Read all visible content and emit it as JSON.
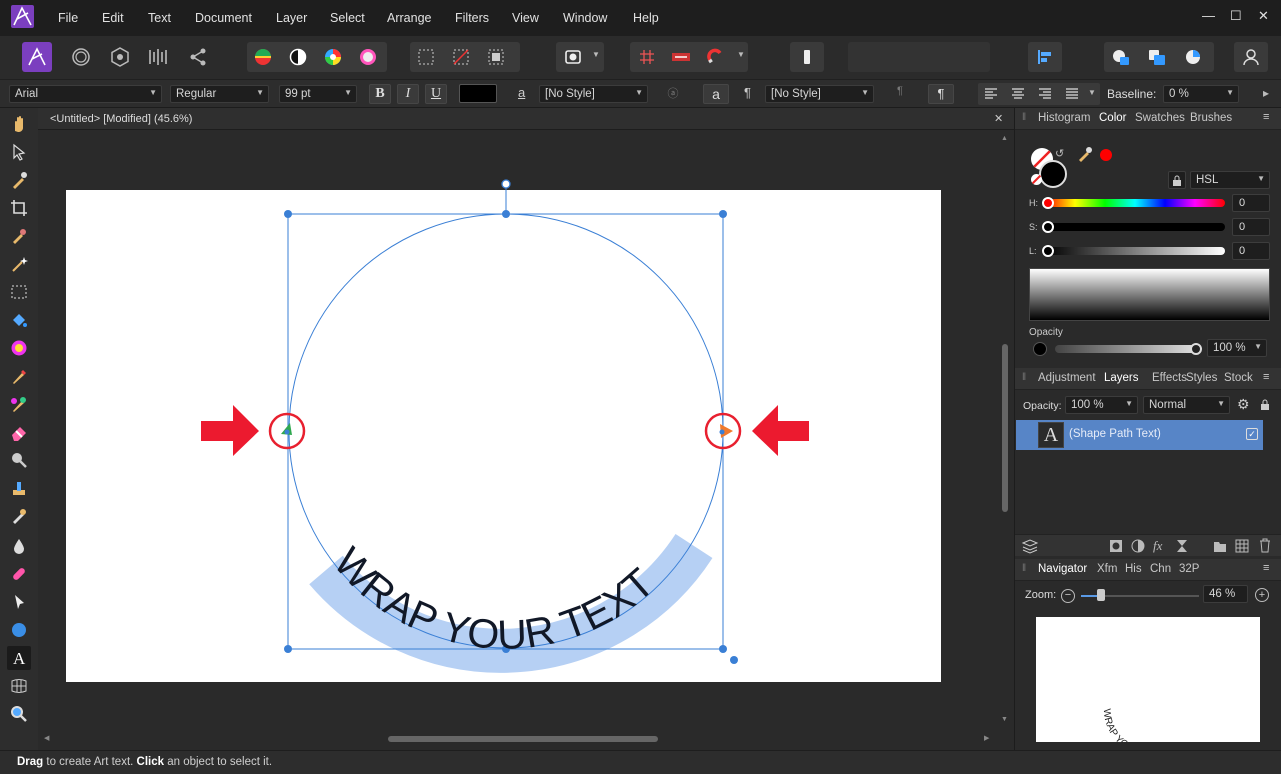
{
  "menu": {
    "items": [
      "File",
      "Edit",
      "Text",
      "Document",
      "Layer",
      "Select",
      "Arrange",
      "Filters",
      "View",
      "Window",
      "Help"
    ],
    "window_controls": {
      "minimize": "—",
      "maximize": "☐",
      "close": "✕"
    }
  },
  "toolbar": {
    "personas": [
      "photo-persona-icon",
      "liquify-persona-icon",
      "develop-persona-icon",
      "tone-mapping-persona-icon",
      "export-persona-icon"
    ],
    "icons": [
      "color-wheel-icon",
      "contrast-icon",
      "hue-icon",
      "white-balance-icon",
      "marquee-icon",
      "deselect-icon",
      "invert-selection-icon",
      "quick-mask-icon",
      "grid-icon",
      "assistant-icon",
      "snapping-icon",
      "snapping-options-icon",
      "insert-icon",
      "align-icon",
      "boolean-add-icon",
      "boolean-subtract-icon",
      "boolean-intersect-icon",
      "user-icon"
    ]
  },
  "context": {
    "font_family": "Arial",
    "font_style": "Regular",
    "font_size": "99 pt",
    "bold": "B",
    "italic": "I",
    "underline": "U",
    "char_style": "[No Style]",
    "para_style": "[No Style]",
    "case_glyph": "a",
    "case_glyph2": "a",
    "pilcrow": "¶",
    "baseline_label": "Baseline:",
    "baseline_value": "0 %",
    "fill_color": "#000000"
  },
  "document": {
    "tab_title": "<Untitled> [Modified] (45.6%)",
    "close": "✕",
    "path_text": "WRAP YOUR TEXT"
  },
  "color_panel": {
    "tabs": [
      "Histogram",
      "Color",
      "Swatches",
      "Brushes"
    ],
    "active_tab": "Color",
    "model": "HSL",
    "sliders": [
      {
        "label": "H:",
        "value": "0"
      },
      {
        "label": "S:",
        "value": "0"
      },
      {
        "label": "L:",
        "value": "0"
      }
    ],
    "opacity_label": "Opacity",
    "opacity_value": "100 %",
    "primary_color": "#000000",
    "accent_color": "#ff0000"
  },
  "layers_panel": {
    "tabs": [
      "Adjustment",
      "Layers",
      "Effects",
      "Styles",
      "Stock"
    ],
    "active_tab": "Layers",
    "opacity_label": "Opacity:",
    "opacity_value": "100 %",
    "blend_mode": "Normal",
    "layer_thumb": "A",
    "layer_name": "(Shape Path Text)"
  },
  "navigator_panel": {
    "tabs": [
      "Navigator",
      "Xfm",
      "His",
      "Chn",
      "32P"
    ],
    "active_tab": "Navigator",
    "zoom_label": "Zoom:",
    "zoom_value": "46 %",
    "preview_text": "WRAP YOUR TEXT"
  },
  "status": {
    "drag": "Drag",
    "text1": " to create Art text. ",
    "click": "Click",
    "text2": " an object to select it."
  }
}
